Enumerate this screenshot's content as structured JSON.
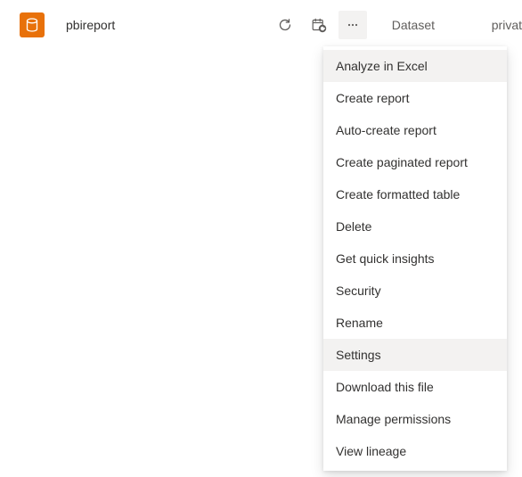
{
  "row": {
    "item_name": "pbireport",
    "type_label": "Dataset",
    "owner_label": "privat"
  },
  "menu": {
    "analyze_excel": "Analyze in Excel",
    "create_report": "Create report",
    "auto_create_report": "Auto-create report",
    "create_paginated": "Create paginated report",
    "create_formatted_table": "Create formatted table",
    "delete": "Delete",
    "quick_insights": "Get quick insights",
    "security": "Security",
    "rename": "Rename",
    "settings": "Settings",
    "download_file": "Download this file",
    "manage_permissions": "Manage permissions",
    "view_lineage": "View lineage"
  }
}
